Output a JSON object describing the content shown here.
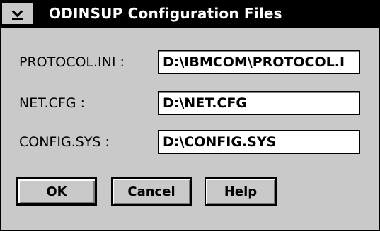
{
  "window": {
    "title": "ODINSUP Configuration Files",
    "system_menu_icon": "system-menu-chevron"
  },
  "fields": [
    {
      "label": "PROTOCOL.INI :",
      "value": "D:\\IBMCOM\\PROTOCOL.I"
    },
    {
      "label": "NET.CFG :",
      "value": "D:\\NET.CFG"
    },
    {
      "label": "CONFIG.SYS :",
      "value": "D:\\CONFIG.SYS"
    }
  ],
  "buttons": {
    "ok": "OK",
    "cancel": "Cancel",
    "help": "Help"
  }
}
